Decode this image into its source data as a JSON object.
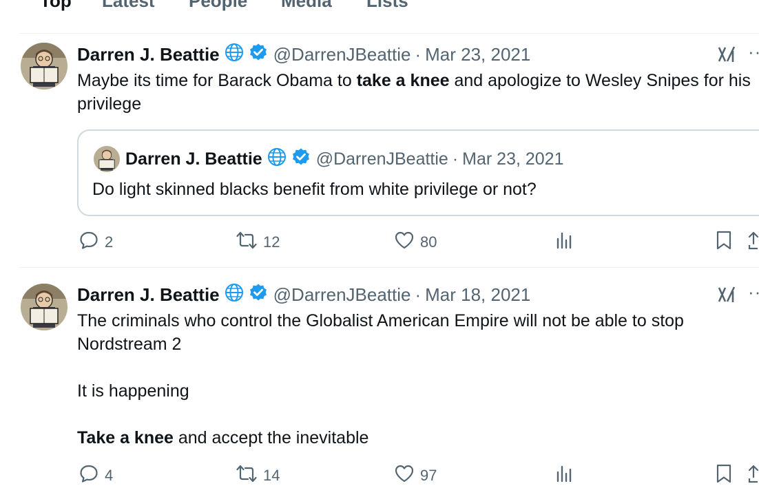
{
  "tabs": [
    "Top",
    "Latest",
    "People",
    "Media",
    "Lists"
  ],
  "tweets": [
    {
      "author": "Darren J. Beattie",
      "handle": "@DarrenJBeattie",
      "sep": "·",
      "date": "Mar 23, 2021",
      "text_parts": [
        "Maybe its time for Barack Obama to ",
        "take a knee",
        " and apologize to Wesley Snipes for his privilege"
      ],
      "quote": {
        "author": "Darren J. Beattie",
        "handle": "@DarrenJBeattie",
        "sep": "·",
        "date": "Mar 23, 2021",
        "text": "Do light skinned blacks benefit from white privilege or not?"
      },
      "replies": "2",
      "reposts": "12",
      "likes": "80",
      "more": "··"
    },
    {
      "author": "Darren J. Beattie",
      "handle": "@DarrenJBeattie",
      "sep": "·",
      "date": "Mar 18, 2021",
      "text_line1": "The criminals who control the Globalist American Empire will not be able to stop Nordstream 2",
      "text_line2": "It is happening",
      "text_line3_bold": "Take a knee",
      "text_line3_rest": " and accept the inevitable",
      "replies": "4",
      "reposts": "14",
      "likes": "97",
      "more": "··"
    }
  ],
  "colors": {
    "verified": "#1d9bf0",
    "globe": "#1d9bf0",
    "muted": "#536471",
    "text": "#0f1419"
  },
  "icons": [
    "globe-icon",
    "verified-badge-icon",
    "grok-icon",
    "more-icon",
    "reply-icon",
    "repost-icon",
    "like-icon",
    "views-icon",
    "bookmark-icon",
    "share-icon"
  ]
}
